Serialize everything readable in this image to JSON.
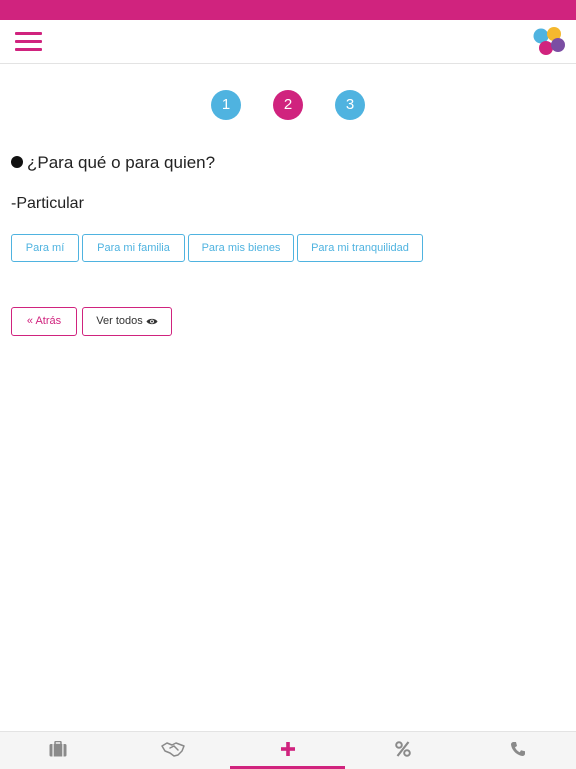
{
  "steps": [
    {
      "label": "1",
      "active": false
    },
    {
      "label": "2",
      "active": true
    },
    {
      "label": "3",
      "active": false
    }
  ],
  "question": "¿Para qué o para quien?",
  "category": "-Particular",
  "options": [
    "Para mí",
    "Para mi familia",
    "Para mis bienes",
    "Para mi tranquilidad"
  ],
  "nav": {
    "back_label": "« Atrás",
    "view_all_label": "Ver todos"
  },
  "bottom_tabs": [
    {
      "icon": "briefcase-icon",
      "active": false
    },
    {
      "icon": "handshake-icon",
      "active": false
    },
    {
      "icon": "plus-icon",
      "active": true
    },
    {
      "icon": "percent-icon",
      "active": false
    },
    {
      "icon": "phone-icon",
      "active": false
    }
  ],
  "colors": {
    "brand_pink": "#d0237e",
    "brand_blue": "#4fb3e0",
    "logo_yellow": "#f5b82e",
    "logo_purple": "#7b4ea3"
  }
}
